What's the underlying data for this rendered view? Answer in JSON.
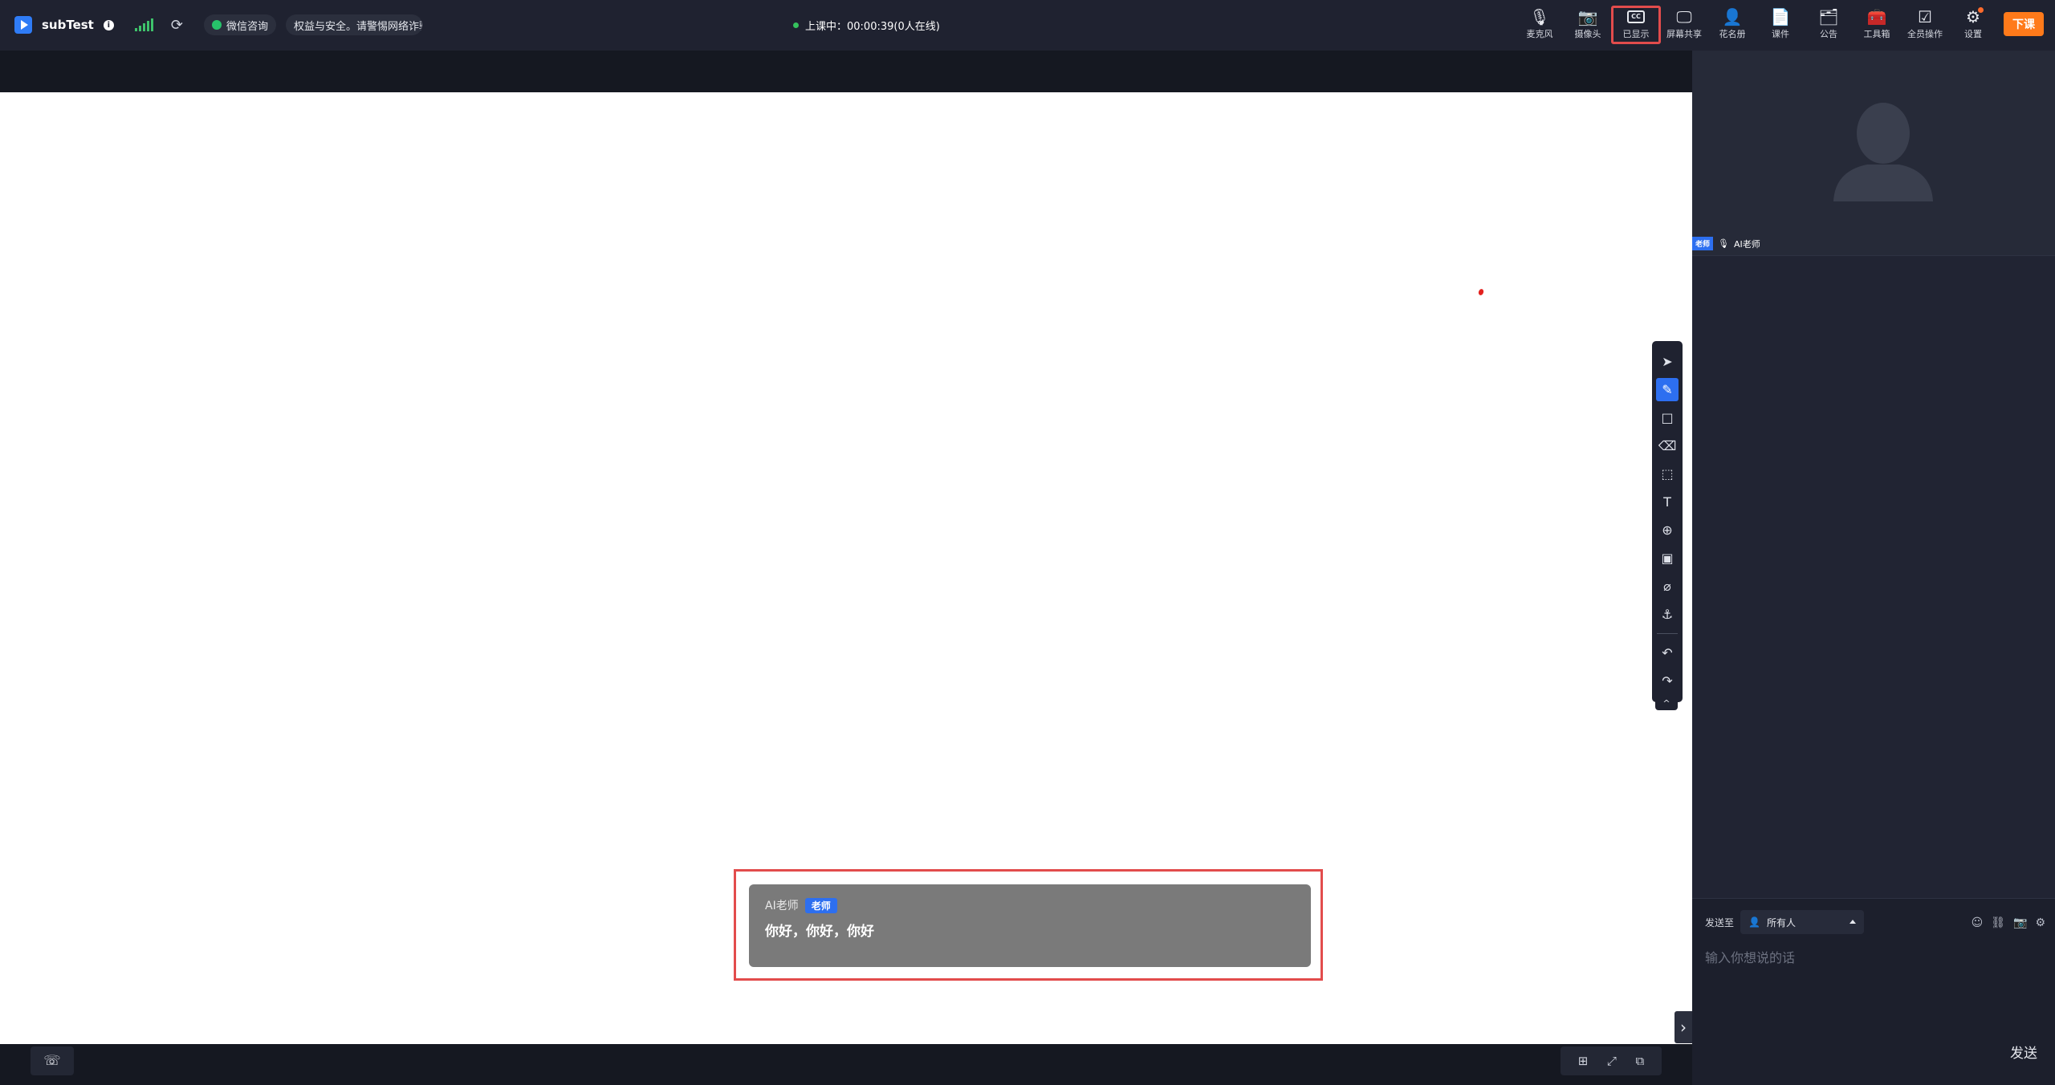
{
  "header": {
    "course_name": "subTest",
    "info_icon_glyph": "i",
    "refresh_glyph": "⟳",
    "wechat_label": "微信咨询",
    "notice_text": "权益与安全。请警惕网络诈骗",
    "status_text": "上课中：00:00:39(0人在线)",
    "tools": [
      {
        "label": "麦克风",
        "icon": "microphone-icon",
        "glyph": "🎙"
      },
      {
        "label": "摄像头",
        "icon": "camera-off-icon",
        "glyph": "📷"
      },
      {
        "label": "已显示",
        "icon": "cc-icon",
        "glyph": "CC"
      },
      {
        "label": "屏幕共享",
        "icon": "screen-share-icon",
        "glyph": "🖵"
      },
      {
        "label": "花名册",
        "icon": "roster-icon",
        "glyph": "👤"
      },
      {
        "label": "课件",
        "icon": "courseware-icon",
        "glyph": "📄"
      },
      {
        "label": "公告",
        "icon": "announcement-icon",
        "glyph": "🗂"
      },
      {
        "label": "工具箱",
        "icon": "toolbox-icon",
        "glyph": "🧰"
      },
      {
        "label": "全员操作",
        "icon": "all-members-icon",
        "glyph": "☑"
      },
      {
        "label": "设置",
        "icon": "settings-icon",
        "glyph": "⚙"
      }
    ],
    "end_class_label": "下课"
  },
  "whiteboard_tools": [
    {
      "name": "select-tool",
      "glyph": "➤"
    },
    {
      "name": "pen-tool",
      "glyph": "✎",
      "active": true
    },
    {
      "name": "rectangle-tool",
      "glyph": "□"
    },
    {
      "name": "eraser-tool",
      "glyph": "⌫"
    },
    {
      "name": "area-select-tool",
      "glyph": "⬚"
    },
    {
      "name": "text-tool",
      "glyph": "T"
    },
    {
      "name": "laser-pointer-tool",
      "glyph": "⊕"
    },
    {
      "name": "image-tool",
      "glyph": "▣"
    },
    {
      "name": "ruler-tool",
      "glyph": "⌀"
    },
    {
      "name": "clear-tool",
      "glyph": "⚓"
    },
    {
      "name": "undo-tool",
      "glyph": "↶"
    },
    {
      "name": "redo-tool",
      "glyph": "↷"
    }
  ],
  "whiteboard_collapse_glyph": "^",
  "subtitle": {
    "speaker": "AI老师",
    "role": "老师",
    "text": "你好，你好，你好"
  },
  "bottom": {
    "phone_glyph": "☏",
    "right_glyphs": [
      "⊞",
      "⤢",
      "⧉"
    ],
    "expand_glyph": "›"
  },
  "video": {
    "role_tag": "老师",
    "mic_glyph": "🎙",
    "name": "AI老师"
  },
  "chat": {
    "send_to_label": "发送至",
    "send_to_value": "所有人",
    "icons": [
      {
        "name": "emoji-icon",
        "glyph": "☺"
      },
      {
        "name": "link-icon",
        "glyph": "⛓"
      },
      {
        "name": "image-upload-icon",
        "glyph": "📷"
      },
      {
        "name": "chat-settings-icon",
        "glyph": "⚙"
      }
    ],
    "input_placeholder": "输入你想说的话",
    "send_label": "发送"
  },
  "colors": {
    "accent": "#2d6ff0",
    "end_button": "#ff7a1a",
    "highlight_border": "#e24c4c",
    "online_dot": "#35c25d"
  }
}
